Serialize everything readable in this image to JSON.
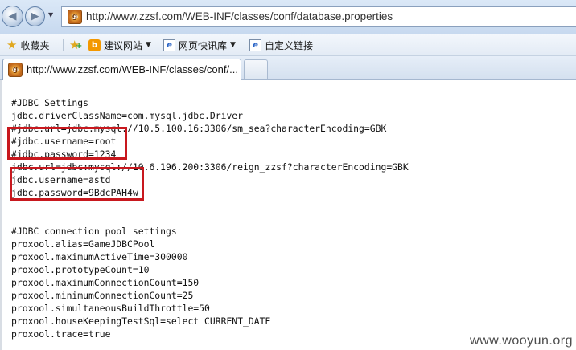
{
  "address_bar": {
    "url": "http://www.zzsf.com/WEB-INF/classes/conf/database.properties",
    "site_icon": "site-favicon-icon"
  },
  "favorites_bar": {
    "favorites_label": "收藏夹",
    "items": [
      {
        "label": "建议网站",
        "icon": "b-icon"
      },
      {
        "label": "网页快讯库",
        "icon": "ie-page-icon"
      },
      {
        "label": "自定义链接",
        "icon": "ie-page-icon"
      }
    ]
  },
  "tabs": [
    {
      "label": "http://www.zzsf.com/WEB-INF/classes/conf/...",
      "active": true
    }
  ],
  "document": {
    "lines": [
      "#JDBC Settings",
      "jdbc.driverClassName=com.mysql.jdbc.Driver",
      "#jdbc.url=jdbc:mysql://10.5.100.16:3306/sm_sea?characterEncoding=GBK",
      "#jdbc.username=root",
      "#jdbc.password=1234",
      "jdbc.url=jdbc:mysql://10.6.196.200:3306/reign_zzsf?characterEncoding=GBK",
      "jdbc.username=astd",
      "jdbc.password=9BdcPAH4w",
      "",
      "",
      "#JDBC connection pool settings",
      "proxool.alias=GameJDBCPool",
      "proxool.maximumActiveTime=300000",
      "proxool.prototypeCount=10",
      "proxool.maximumConnectionCount=150",
      "proxool.minimumConnectionCount=25",
      "proxool.simultaneousBuildThrottle=50",
      "proxool.houseKeepingTestSql=select CURRENT_DATE",
      "proxool.trace=true"
    ]
  },
  "watermark": "www.wooyun.org",
  "colors": {
    "highlight_border": "#c8181e",
    "text": "#111111"
  }
}
